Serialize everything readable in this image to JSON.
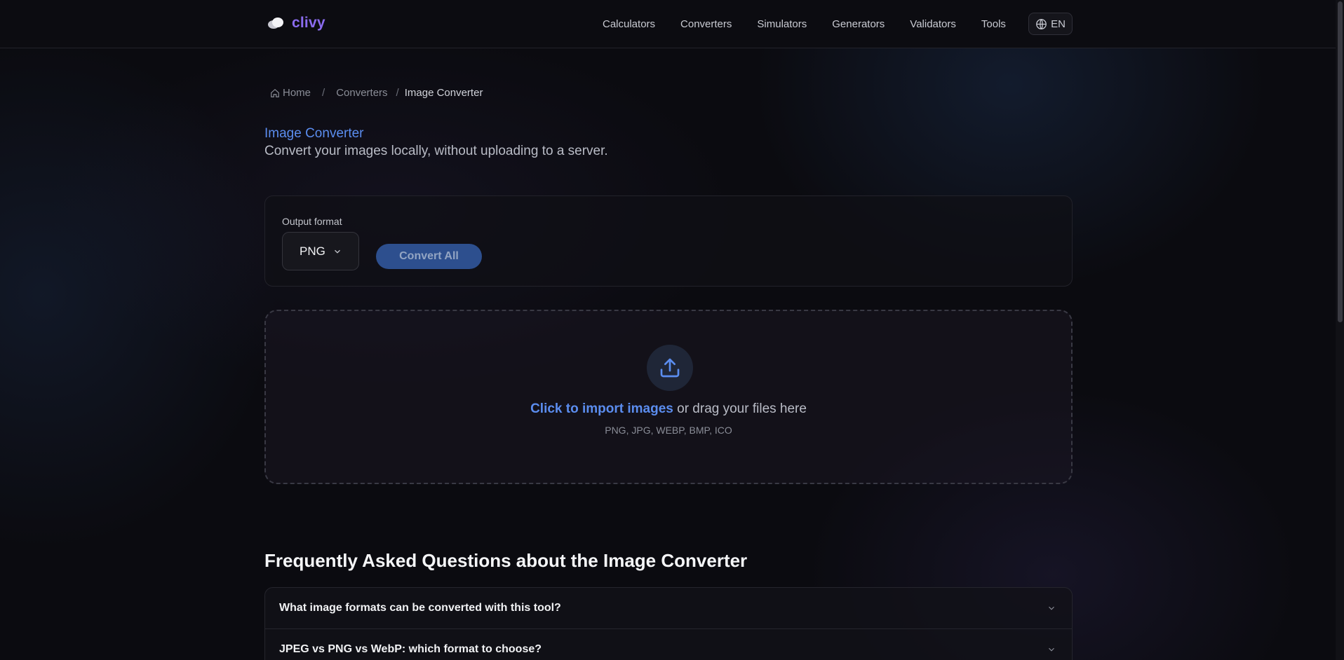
{
  "header": {
    "brand": "clivy",
    "nav": [
      "Calculators",
      "Converters",
      "Simulators",
      "Generators",
      "Validators",
      "Tools"
    ],
    "language": "EN"
  },
  "breadcrumb": {
    "home": "Home",
    "parent": "Converters",
    "current": "Image Converter",
    "separator": "/"
  },
  "page": {
    "title": "Image Converter",
    "subtitle": "Convert your images locally, without uploading to a server."
  },
  "options": {
    "output_format_label": "Output format",
    "output_format_value": "PNG",
    "convert_button": "Convert All"
  },
  "dropzone": {
    "link_text": "Click to import images",
    "rest_text": " or drag your files here",
    "formats": "PNG, JPG, WEBP, BMP, ICO"
  },
  "faq": {
    "title": "Frequently Asked Questions about the Image Converter",
    "items": [
      "What image formats can be converted with this tool?",
      "JPEG vs PNG vs WebP: which format to choose?"
    ]
  },
  "colors": {
    "accent": "#5b8def",
    "brand": "#8b6cf0",
    "button": "#2d4f8e",
    "background": "#0b0b10"
  }
}
